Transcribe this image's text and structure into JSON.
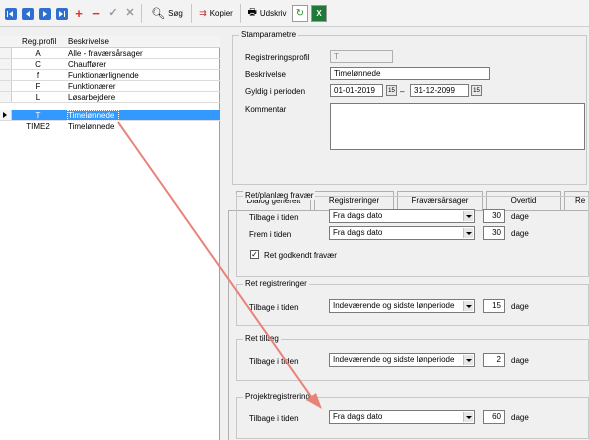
{
  "toolbar": {
    "search_label": "Søg",
    "copy_label": "Kopier",
    "print_label": "Udskriv"
  },
  "grid": {
    "headers": [
      "Reg.profil",
      "Beskrivelse"
    ],
    "rows": [
      {
        "code": "A",
        "desc": "Alle - fraværsårsager"
      },
      {
        "code": "C",
        "desc": "Chauffører"
      },
      {
        "code": "f",
        "desc": "Funktionærlignende"
      },
      {
        "code": "F",
        "desc": "Funktionærer"
      },
      {
        "code": "L",
        "desc": "Løsarbejdere"
      },
      {
        "code": "T",
        "desc": "Timelønnede"
      },
      {
        "code": "TIME2",
        "desc": "Timelønnede"
      }
    ]
  },
  "stamparametre": {
    "title": "Stamparametre",
    "profile_label": "Registreringsprofil",
    "profile_value": "T",
    "desc_label": "Beskrivelse",
    "desc_value": "Timelønnede",
    "period_label": "Gyldig i perioden",
    "date_from": "01-01-2019",
    "date_sep": "–",
    "date_to": "31-12-2099",
    "calendar_glyph": "15",
    "comment_label": "Kommentar"
  },
  "tabs": [
    "Dialog generelt",
    "Registreringer",
    "Fraværsårsager",
    "Overtid",
    "Re"
  ],
  "ret_planlaeg": {
    "title": "Ret/planlæg fravær",
    "back_label": "Tilbage i tiden",
    "back_value": "Fra dags dato",
    "back_days": "30",
    "fwd_label": "Frem i tiden",
    "fwd_value": "Fra dags dato",
    "fwd_days": "30",
    "days_unit": "dage",
    "approved_label": "Ret godkendt fravær",
    "approved_check": "✓"
  },
  "ret_registreringer": {
    "title": "Ret registreringer",
    "back_label": "Tilbage i tiden",
    "back_value": "Indeværende og sidste lønperiode",
    "back_days": "15",
    "days_unit": "dage"
  },
  "ret_tillaeg": {
    "title": "Ret tillæg",
    "back_label": "Tilbage i tiden",
    "back_value": "Indeværende og sidste lønperiode",
    "back_days": "2",
    "days_unit": "dage"
  },
  "projektregistrering": {
    "title": "Projektregistrering",
    "back_label": "Tilbage i tiden",
    "back_value": "Fra dags dato",
    "back_days": "60",
    "days_unit": "dage"
  },
  "colors": {
    "selection": "#3399ff",
    "annotation_arrow": "#e8837a"
  }
}
